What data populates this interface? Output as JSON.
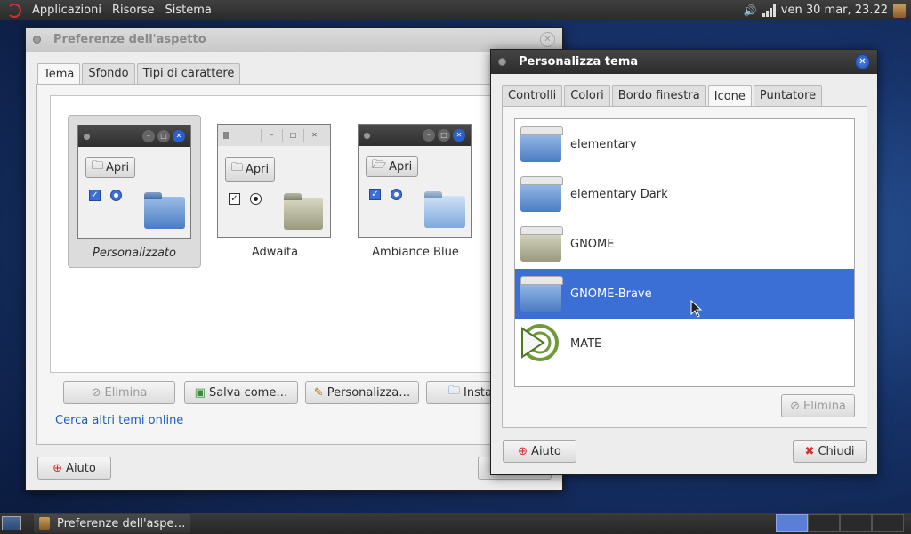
{
  "top_panel": {
    "menus": [
      "Applicazioni",
      "Risorse",
      "Sistema"
    ],
    "clock": "ven 30 mar, 23.22"
  },
  "appearance_window": {
    "title": "Preferenze dell'aspetto",
    "tabs": [
      "Tema",
      "Sfondo",
      "Tipi di carattere"
    ],
    "active_tab": "Tema",
    "themes": [
      {
        "name": "Personalizzato",
        "selected": true,
        "open_label": "Apri"
      },
      {
        "name": "Adwaita",
        "selected": false,
        "open_label": "Apri"
      },
      {
        "name": "Ambiance Blue",
        "selected": false,
        "open_label": "Apri"
      }
    ],
    "buttons": {
      "delete": "Elimina",
      "save_as": "Salva come…",
      "customize": "Personalizza…",
      "install": "Installa…",
      "help": "Aiuto"
    },
    "online_link": "Cerca altri temi online"
  },
  "customize_window": {
    "title": "Personalizza tema",
    "tabs": [
      "Controlli",
      "Colori",
      "Bordo finestra",
      "Icone",
      "Puntatore"
    ],
    "active_tab": "Icone",
    "icon_themes": [
      {
        "name": "elementary",
        "selected": false
      },
      {
        "name": "elementary Dark",
        "selected": false
      },
      {
        "name": "GNOME",
        "selected": false
      },
      {
        "name": "GNOME-Brave",
        "selected": true
      },
      {
        "name": "MATE",
        "selected": false
      }
    ],
    "buttons": {
      "delete": "Elimina",
      "help": "Aiuto",
      "close": "Chiudi"
    }
  },
  "taskbar": {
    "window_label": "Preferenze dell'aspe…"
  },
  "colors": {
    "selection": "#3b6fd6",
    "link": "#1e5ac8",
    "close_red": "#d03030"
  }
}
